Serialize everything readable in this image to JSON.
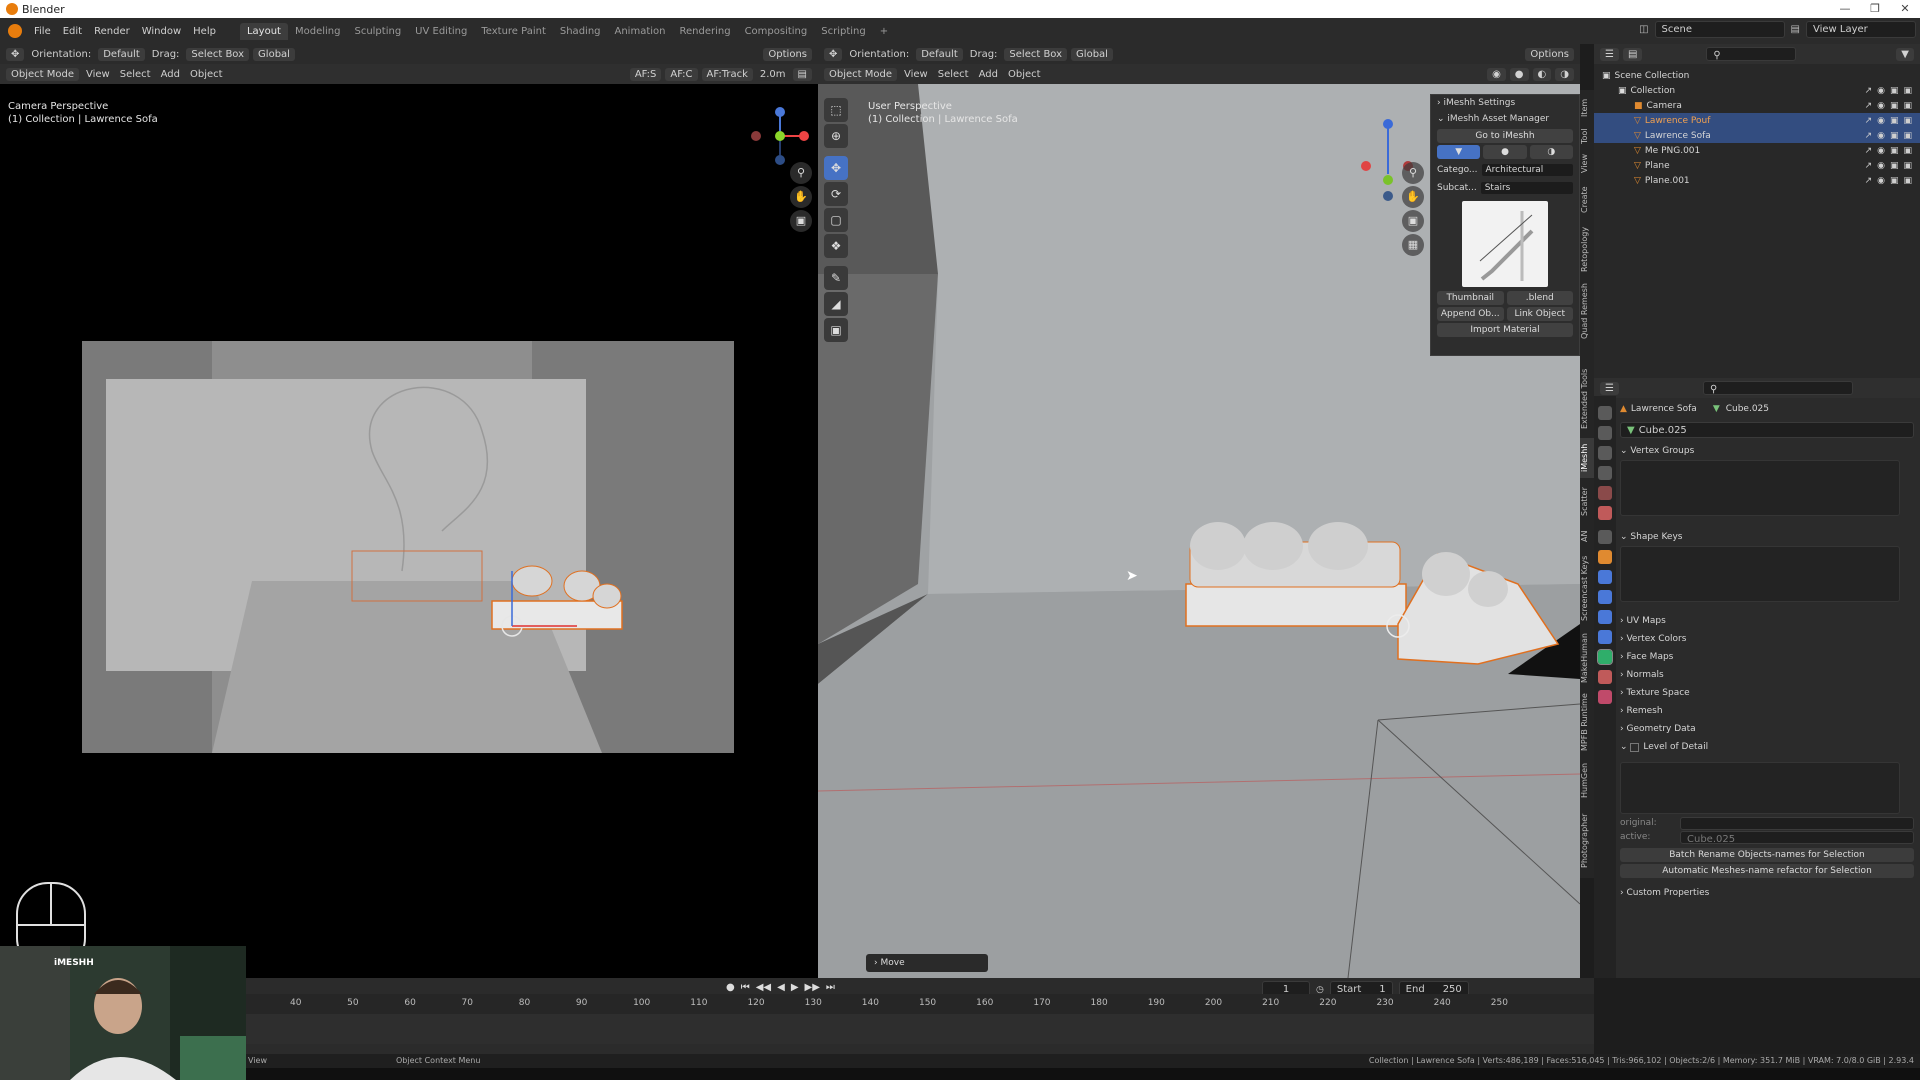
{
  "window": {
    "title": "Blender"
  },
  "menu": [
    "File",
    "Edit",
    "Render",
    "Window",
    "Help"
  ],
  "workspaces": [
    "Layout",
    "Modeling",
    "Sculpting",
    "UV Editing",
    "Texture Paint",
    "Shading",
    "Animation",
    "Rendering",
    "Compositing",
    "Scripting"
  ],
  "active_workspace": "Layout",
  "topbar": {
    "scene": "Scene",
    "view_layer": "View Layer"
  },
  "tool_header": {
    "orientation_label": "Orientation:",
    "orientation_value": "Default",
    "drag_label": "Drag:",
    "drag_value": "Select Box",
    "transform_value": "Global",
    "options": "Options"
  },
  "left_viewport": {
    "mode": "Object Mode",
    "menus": [
      "View",
      "Select",
      "Add",
      "Object"
    ],
    "overlay_title": "Camera Perspective",
    "overlay_subtitle": "(1) Collection | Lawrence Sofa",
    "af_s": "AF:S",
    "af_c": "AF:C",
    "af_track": "AF:Track",
    "af_distance": "2.0m"
  },
  "right_viewport": {
    "mode": "Object Mode",
    "menus": [
      "View",
      "Select",
      "Add",
      "Object"
    ],
    "overlay_title": "User Perspective",
    "overlay_subtitle": "(1) Collection | Lawrence Sofa",
    "operator_panel": "Move"
  },
  "imeshh": {
    "settings": "iMeshh Settings",
    "asset_manager": "iMeshh Asset Manager",
    "go_button": "Go to iMeshh",
    "category_label": "Catego...",
    "category_value": "Architectural",
    "subcategory_label": "Subcat...",
    "subcategory_value": "Stairs",
    "thumbnail_button": "Thumbnail",
    "blend_button": ".blend",
    "append_button": "Append Ob...",
    "link_button": "Link Object",
    "import_material": "Import Material"
  },
  "side_tabs": [
    "Item",
    "Tool",
    "View",
    "Create",
    "Retopology",
    "Quad Remesh",
    "Extended Tools",
    "iMeshh",
    "Scatter",
    "AN",
    "Screencast Keys",
    "MakeHuman",
    "MPFB Runtime",
    "HumGen",
    "Photographer"
  ],
  "outliner": {
    "root": "Scene Collection",
    "items": [
      {
        "name": "Collection",
        "depth": 1,
        "selected": false,
        "type": "collection"
      },
      {
        "name": "Camera",
        "depth": 2,
        "selected": false,
        "type": "camera"
      },
      {
        "name": "Lawrence Pouf",
        "depth": 2,
        "selected": true,
        "type": "mesh"
      },
      {
        "name": "Lawrence Sofa",
        "depth": 2,
        "selected": true,
        "type": "mesh"
      },
      {
        "name": "Me PNG.001",
        "depth": 2,
        "selected": false,
        "type": "mesh"
      },
      {
        "name": "Plane",
        "depth": 2,
        "selected": false,
        "type": "mesh"
      },
      {
        "name": "Plane.001",
        "depth": 2,
        "selected": false,
        "type": "mesh"
      }
    ]
  },
  "properties": {
    "object_name": "Lawrence Sofa",
    "mesh_name": "Cube.025",
    "data_name": "Cube.025",
    "sections": {
      "vertex_groups": "Vertex Groups",
      "shape_keys": "Shape Keys",
      "collapsed": [
        "UV Maps",
        "Vertex Colors",
        "Face Maps",
        "Normals",
        "Texture Space",
        "Remesh",
        "Geometry Data"
      ],
      "lod": "Level of Detail",
      "custom_properties": "Custom Properties"
    },
    "lod_original_label": "original:",
    "lod_active_label": "active:",
    "lod_active_value": "Cube.025",
    "batch_rename": "Batch Rename Objects-names for Selection",
    "auto_rename": "Automatic Meshes-name refactor for Selection"
  },
  "timeline": {
    "current_frame": "1",
    "start_label": "Start",
    "start": "1",
    "end_label": "End",
    "end": "250",
    "ticks": [
      "40",
      "50",
      "60",
      "70",
      "80",
      "90",
      "100",
      "110",
      "120",
      "130",
      "140",
      "150",
      "160",
      "170",
      "180",
      "190",
      "200",
      "210",
      "220",
      "230",
      "240",
      "250"
    ]
  },
  "statusbar": {
    "left": "View",
    "middle": "Object Context Menu",
    "right": "Collection | Lawrence Sofa | Verts:486,189 | Faces:516,045 | Tris:966,102 | Objects:2/6 | Memory: 351.7 MiB | VRAM: 7.0/8.0 GiB | 2.93.4"
  },
  "webcam": {
    "brand": "iMESHH"
  },
  "colors": {
    "accent": "#e87d0d",
    "selected_row": "#334d80",
    "viewport_bg": "#9a9d9f"
  }
}
